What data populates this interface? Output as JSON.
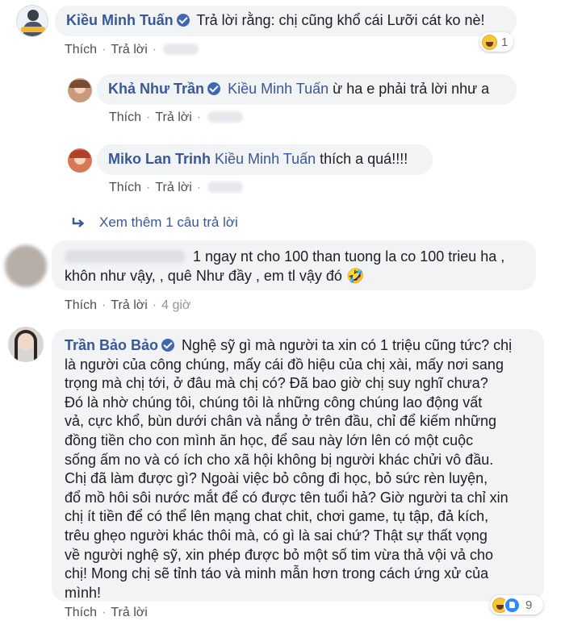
{
  "actions": {
    "like": "Thích",
    "reply": "Trả lời"
  },
  "comments": [
    {
      "author": "Kiều Minh Tuấn",
      "text": "Trả lời rằng: chị cũng khổ cái Lưỡi cát ko nè!",
      "reaction_count": "1",
      "reaction_icons": [
        "haha-icon"
      ]
    },
    {
      "author": "Khả Như Trần",
      "mention": "Kiều Minh Tuấn",
      "text": "ừ ha e phải trả lời như a"
    },
    {
      "author": "Miko Lan Trinh",
      "mention": "Kiều Minh Tuấn",
      "text": "thích a quá!!!!"
    },
    {
      "author": "",
      "line1": "1 ngay nt cho 100 than tuong la co 100 trieu ha ,",
      "line2": "khôn như vậy, , quê Như đầy , em tl vậy đó 🤣",
      "time": "4 giờ"
    },
    {
      "author": "Trần Bảo Bảo",
      "lines": [
        "Nghệ sỹ gì mà người ta xin có 1 triệu cũng tức? chị",
        "là người của công chúng, mấy cái đồ hiệu của chị xài, mấy nơi sang",
        "trọng mà chị tới, ở đâu mà chị có? Đã bao giờ chị suy nghĩ chưa?",
        "Đó là nhờ chúng tôi, chúng tôi là những công chúng lao động vất",
        "vả, cực khổ, bùn dưới chân và nắng ở trên đầu, chỉ để kiếm những",
        "đồng tiền cho con mình ăn học, để sau này lớn lên có một cuộc",
        "sống ấm no và có ích cho xã hội không bị người khác chửi vô đầu.",
        "Chị đã làm được gì? Ngoài việc bỏ công đi học, bỏ sức rèn luyện,",
        "đổ mồ hôi sôi nước mắt để có được tên tuổi hả? Giờ người ta chỉ xin",
        "chị ít tiền để có thể lên mạng chat chit, chơi game, tụ tập, đả kích,",
        "trêu ghẹo người khác thôi mà, có gì là sai chứ? Thật sự thất vọng",
        "về người nghệ sỹ, xin phép được bỏ một số tim vừa thả vội vả cho",
        "chị! Mong chị sẽ tỉnh táo và minh mẫn hơn trong cách ứng xử của",
        "mình!"
      ],
      "reaction_count": "9",
      "reaction_icons": [
        "haha-icon",
        "like-icon"
      ]
    }
  ],
  "more_replies": "Xem thêm 1 câu trả lời",
  "colors": {
    "name": "#385898",
    "bubble": "#f2f3f5",
    "meta": "#4b4f56"
  }
}
